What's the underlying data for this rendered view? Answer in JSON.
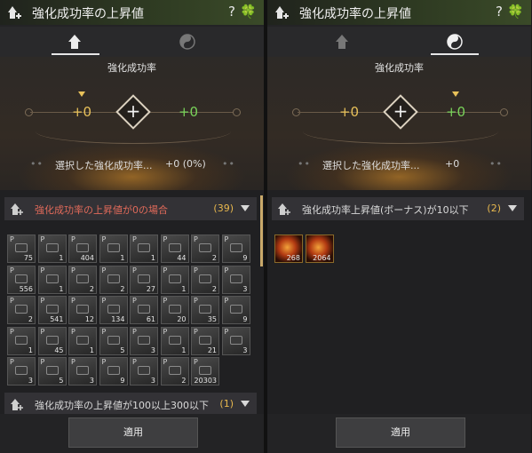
{
  "window_title": "強化成功率の上昇値",
  "help_symbol": "?",
  "clover_symbol": "🍀",
  "panels": [
    {
      "id": "left",
      "active_tab": "left",
      "hero": {
        "label": "強化成功率",
        "left_value": "+0",
        "right_value": "+0",
        "pointer_on": "left",
        "selected_text": "選択した強化成功率...",
        "selected_value": "+0 (0%)"
      },
      "groups": [
        {
          "label": "強化成功率の上昇値が0の場合",
          "count": "(39)",
          "label_color": "#e06a5a"
        },
        {
          "label": "強化成功率の上昇値が100以上300以下",
          "count": "(1)",
          "label_color": "#dcdcdc"
        }
      ],
      "items": [
        "75",
        "1",
        "404",
        "1",
        "1",
        "44",
        "2",
        "9",
        "556",
        "1",
        "2",
        "2",
        "27",
        "1",
        "2",
        "3",
        "2",
        "541",
        "12",
        "134",
        "61",
        "20",
        "35",
        "9",
        "1",
        "45",
        "1",
        "5",
        "3",
        "1",
        "21",
        "3",
        "3",
        "5",
        "3",
        "9",
        "3",
        "2",
        "20303"
      ],
      "apply_label": "適用"
    },
    {
      "id": "right",
      "active_tab": "right",
      "hero": {
        "label": "強化成功率",
        "left_value": "+0",
        "right_value": "+0",
        "pointer_on": "right",
        "selected_text": "選択した強化成功率...",
        "selected_value": "+0"
      },
      "groups": [
        {
          "label": "強化成功率上昇値(ボーナス)が10以下",
          "count": "(2)",
          "label_color": "#dcdcdc"
        }
      ],
      "items": [
        "268",
        "2064"
      ],
      "apply_label": "適用"
    }
  ],
  "colors": {
    "accent_gold": "#e8c15a",
    "accent_green": "#79d35a",
    "warning_red": "#e06a5a"
  },
  "icons": {
    "title": "enhance-arrow-icon",
    "tab_left": "enhance-arrow-icon",
    "tab_right": "yin-yang-icon",
    "help": "help-icon",
    "clover": "clover-icon"
  }
}
